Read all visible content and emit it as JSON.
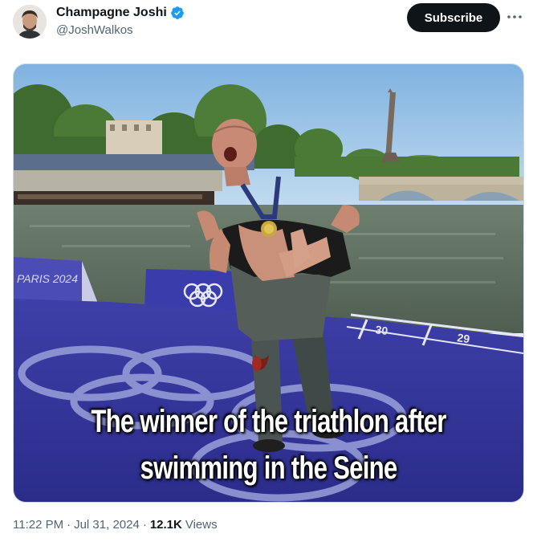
{
  "author": {
    "display_name": "Champagne Joshi",
    "handle": "@JoshWalkos",
    "verified_icon": "verified-badge-icon"
  },
  "actions": {
    "subscribe_label": "Subscribe",
    "more_icon": "more-horizontal-icon"
  },
  "media": {
    "caption_line1": "The winner of the triathlon after",
    "caption_line2": "swimming in the Seine",
    "banner_text": "PARIS 2024",
    "lane_numbers": [
      "30",
      "29"
    ]
  },
  "meta": {
    "time": "11:22 PM",
    "date": "Jul 31, 2024",
    "views_count": "12.1K",
    "views_label": "Views",
    "separator": "·"
  },
  "colors": {
    "text_primary": "#0f1419",
    "text_secondary": "#536471",
    "verified_blue": "#1d9bf0",
    "button_bg": "#0f1419"
  }
}
